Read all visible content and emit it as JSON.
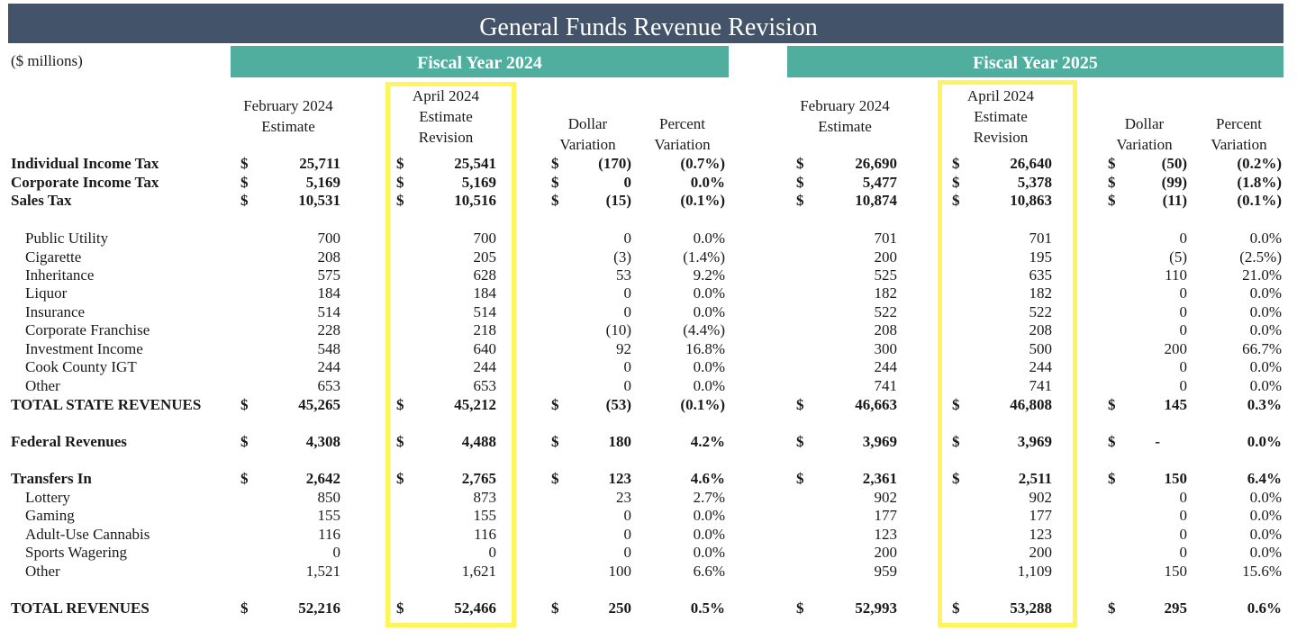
{
  "title": "General Funds Revenue Revision",
  "units": "($ millions)",
  "fiscal_years": [
    {
      "label": "Fiscal Year 2024",
      "columns": [
        "February 2024 Estimate",
        "April 2024 Estimate Revision",
        "Dollar Variation",
        "Percent Variation"
      ]
    },
    {
      "label": "Fiscal Year 2025",
      "columns": [
        "February 2024 Estimate",
        "April 2024 Estimate Revision",
        "Dollar Variation",
        "Percent Variation"
      ]
    }
  ],
  "headers": {
    "feb_1": "February 2024",
    "feb_2": "Estimate",
    "apr_1": "April 2024",
    "apr_2": "Estimate",
    "apr_3": "Revision",
    "dol_1": "Dollar",
    "dol_2": "Variation",
    "pct_1": "Percent",
    "pct_2": "Variation"
  },
  "highlight_color": "#fdf55b",
  "rows": [
    {
      "label": "Individual Income Tax",
      "style": "bold",
      "dollar": true,
      "fy24": [
        "25,711",
        "25,541",
        "(170)",
        "(0.7%)"
      ],
      "fy25": [
        "26,690",
        "26,640",
        "(50)",
        "(0.2%)"
      ]
    },
    {
      "label": "Corporate Income Tax",
      "style": "bold",
      "dollar": true,
      "fy24": [
        "5,169",
        "5,169",
        "0",
        "0.0%"
      ],
      "fy25": [
        "5,477",
        "5,378",
        "(99)",
        "(1.8%)"
      ]
    },
    {
      "label": "Sales Tax",
      "style": "bold",
      "dollar": true,
      "fy24": [
        "10,531",
        "10,516",
        "(15)",
        "(0.1%)"
      ],
      "fy25": [
        "10,874",
        "10,863",
        "(11)",
        "(0.1%)"
      ]
    },
    {
      "label": "Public Utility",
      "style": "sub",
      "dollar": false,
      "fy24": [
        "700",
        "700",
        "0",
        "0.0%"
      ],
      "fy25": [
        "701",
        "701",
        "0",
        "0.0%"
      ]
    },
    {
      "label": "Cigarette",
      "style": "sub",
      "dollar": false,
      "fy24": [
        "208",
        "205",
        "(3)",
        "(1.4%)"
      ],
      "fy25": [
        "200",
        "195",
        "(5)",
        "(2.5%)"
      ]
    },
    {
      "label": "Inheritance",
      "style": "sub",
      "dollar": false,
      "fy24": [
        "575",
        "628",
        "53",
        "9.2%"
      ],
      "fy25": [
        "525",
        "635",
        "110",
        "21.0%"
      ]
    },
    {
      "label": "Liquor",
      "style": "sub",
      "dollar": false,
      "fy24": [
        "184",
        "184",
        "0",
        "0.0%"
      ],
      "fy25": [
        "182",
        "182",
        "0",
        "0.0%"
      ]
    },
    {
      "label": "Insurance",
      "style": "sub",
      "dollar": false,
      "fy24": [
        "514",
        "514",
        "0",
        "0.0%"
      ],
      "fy25": [
        "522",
        "522",
        "0",
        "0.0%"
      ]
    },
    {
      "label": "Corporate Franchise",
      "style": "sub",
      "dollar": false,
      "fy24": [
        "228",
        "218",
        "(10)",
        "(4.4%)"
      ],
      "fy25": [
        "208",
        "208",
        "0",
        "0.0%"
      ]
    },
    {
      "label": "Investment Income",
      "style": "sub",
      "dollar": false,
      "fy24": [
        "548",
        "640",
        "92",
        "16.8%"
      ],
      "fy25": [
        "300",
        "500",
        "200",
        "66.7%"
      ]
    },
    {
      "label": "Cook County IGT",
      "style": "sub",
      "dollar": false,
      "fy24": [
        "244",
        "244",
        "0",
        "0.0%"
      ],
      "fy25": [
        "244",
        "244",
        "0",
        "0.0%"
      ]
    },
    {
      "label": "Other",
      "style": "sub",
      "dollar": false,
      "fy24": [
        "653",
        "653",
        "0",
        "0.0%"
      ],
      "fy25": [
        "741",
        "741",
        "0",
        "0.0%"
      ]
    },
    {
      "label": "TOTAL STATE REVENUES",
      "style": "bold",
      "dollar": true,
      "fy24": [
        "45,265",
        "45,212",
        "(53)",
        "(0.1%)"
      ],
      "fy25": [
        "46,663",
        "46,808",
        "145",
        "0.3%"
      ]
    },
    {
      "label": "Federal Revenues",
      "style": "bold",
      "dollar": true,
      "fy24": [
        "4,308",
        "4,488",
        "180",
        "4.2%"
      ],
      "fy25": [
        "3,969",
        "3,969",
        "-",
        "0.0%"
      ]
    },
    {
      "label": "Transfers In",
      "style": "bold",
      "dollar": true,
      "fy24": [
        "2,642",
        "2,765",
        "123",
        "4.6%"
      ],
      "fy25": [
        "2,361",
        "2,511",
        "150",
        "6.4%"
      ]
    },
    {
      "label": "Lottery",
      "style": "sub",
      "dollar": false,
      "fy24": [
        "850",
        "873",
        "23",
        "2.7%"
      ],
      "fy25": [
        "902",
        "902",
        "0",
        "0.0%"
      ]
    },
    {
      "label": "Gaming",
      "style": "sub",
      "dollar": false,
      "fy24": [
        "155",
        "155",
        "0",
        "0.0%"
      ],
      "fy25": [
        "177",
        "177",
        "0",
        "0.0%"
      ]
    },
    {
      "label": "Adult-Use Cannabis",
      "style": "sub",
      "dollar": false,
      "fy24": [
        "116",
        "116",
        "0",
        "0.0%"
      ],
      "fy25": [
        "123",
        "123",
        "0",
        "0.0%"
      ]
    },
    {
      "label": "Sports Wagering",
      "style": "sub",
      "dollar": false,
      "fy24": [
        "0",
        "0",
        "0",
        "0.0%"
      ],
      "fy25": [
        "200",
        "200",
        "0",
        "0.0%"
      ]
    },
    {
      "label": "Other",
      "style": "sub",
      "dollar": false,
      "fy24": [
        "1,521",
        "1,621",
        "100",
        "6.6%"
      ],
      "fy25": [
        "959",
        "1,109",
        "150",
        "15.6%"
      ]
    },
    {
      "label": "TOTAL REVENUES",
      "style": "bold",
      "dollar": true,
      "fy24": [
        "52,216",
        "52,466",
        "250",
        "0.5%"
      ],
      "fy25": [
        "52,993",
        "53,288",
        "295",
        "0.6%"
      ]
    }
  ],
  "currency_symbol": "$"
}
